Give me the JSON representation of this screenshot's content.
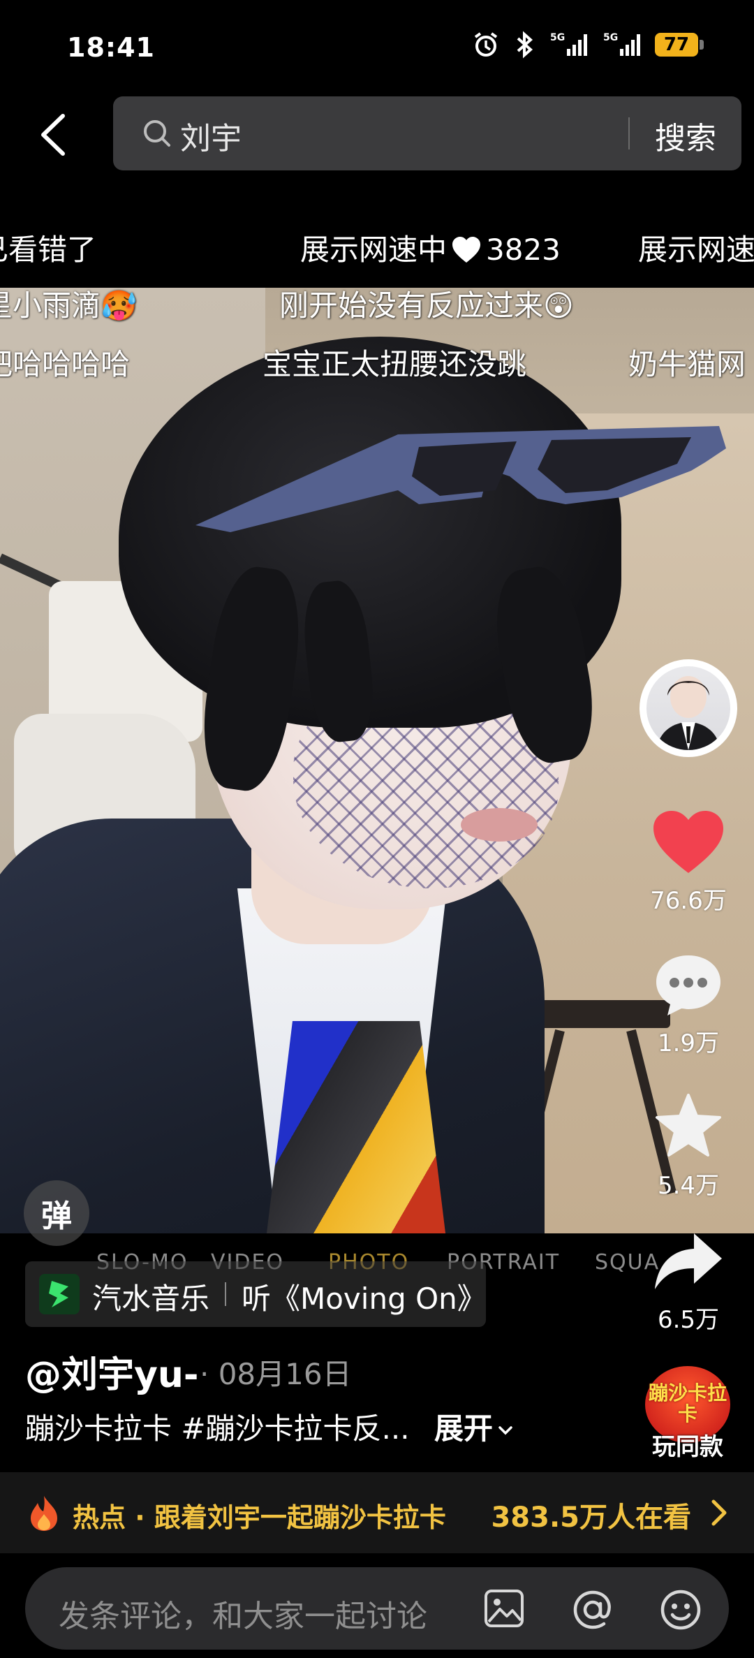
{
  "status_bar": {
    "time": "18:41",
    "battery": "77",
    "network_label_1": "5G",
    "network_label_2": "5G"
  },
  "search": {
    "query": "刘宇",
    "button_label": "搜索"
  },
  "danmaku": {
    "top_row": [
      {
        "text": "已看错了"
      },
      {
        "text": "展示网速中",
        "likes": "3823"
      },
      {
        "text": "展示网速"
      }
    ],
    "row2": [
      "星小雨滴🥵",
      "刚开始没有反应过来😲"
    ],
    "row3": [
      "吧哈哈哈哈",
      "宝宝正太扭腰还没跳",
      "奶牛猫网"
    ],
    "toggle_label": "弹"
  },
  "camera_modes": [
    "SLO-MO",
    "VIDEO",
    "PHOTO",
    "PORTRAIT",
    "SQUA"
  ],
  "actions": {
    "likes": "76.6万",
    "comments": "1.9万",
    "favorites": "5.4万",
    "shares": "6.5万",
    "accent_like_color": "#f2414f"
  },
  "music": {
    "app": "汽水音乐",
    "song": "听《Moving On》"
  },
  "post": {
    "author": "@刘宇yu-",
    "date": "· 08月16日",
    "caption": "蹦沙卡拉卡 #蹦沙卡拉卡反...",
    "expand_label": "展开"
  },
  "same_style": {
    "logo_text": "蹦沙卡拉卡",
    "label": "玩同款"
  },
  "hot": {
    "text": "热点 · 跟着刘宇一起蹦沙卡拉卡",
    "count": "383.5万人在看",
    "accent_color": "#f2c342"
  },
  "comment": {
    "placeholder": "发条评论，和大家一起讨论"
  }
}
